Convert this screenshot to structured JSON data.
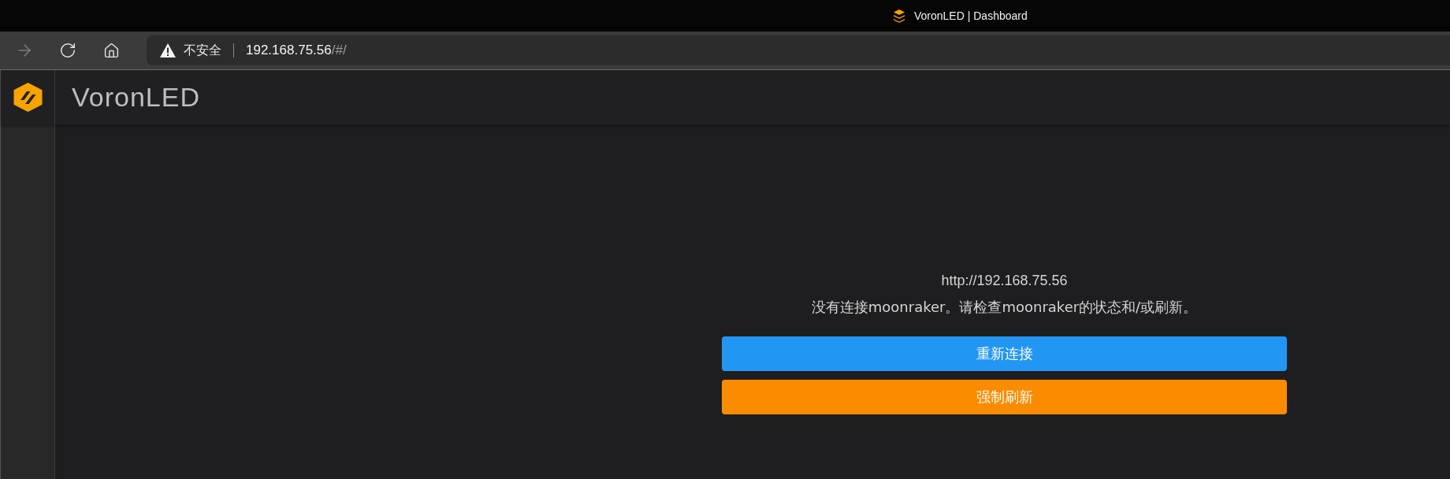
{
  "window": {
    "title": "VoronLED | Dashboard"
  },
  "browser": {
    "nav_buttons": [
      {
        "kind": "forward",
        "disabled": true
      },
      {
        "kind": "reload",
        "disabled": false
      },
      {
        "kind": "home",
        "disabled": false
      }
    ],
    "security_label": "不安全",
    "url": {
      "host": "192.168.75.56",
      "path": "/#/"
    }
  },
  "app_bar": {
    "title": "VoronLED"
  },
  "connection_dialog": {
    "url": "http://192.168.75.56",
    "message": "没有连接moonraker。请检查moonraker的状态和/或刷新。",
    "buttons": [
      {
        "label": "重新连接",
        "color": "#2196f3"
      },
      {
        "label": "强制刷新",
        "color": "#fb8c00"
      }
    ]
  }
}
